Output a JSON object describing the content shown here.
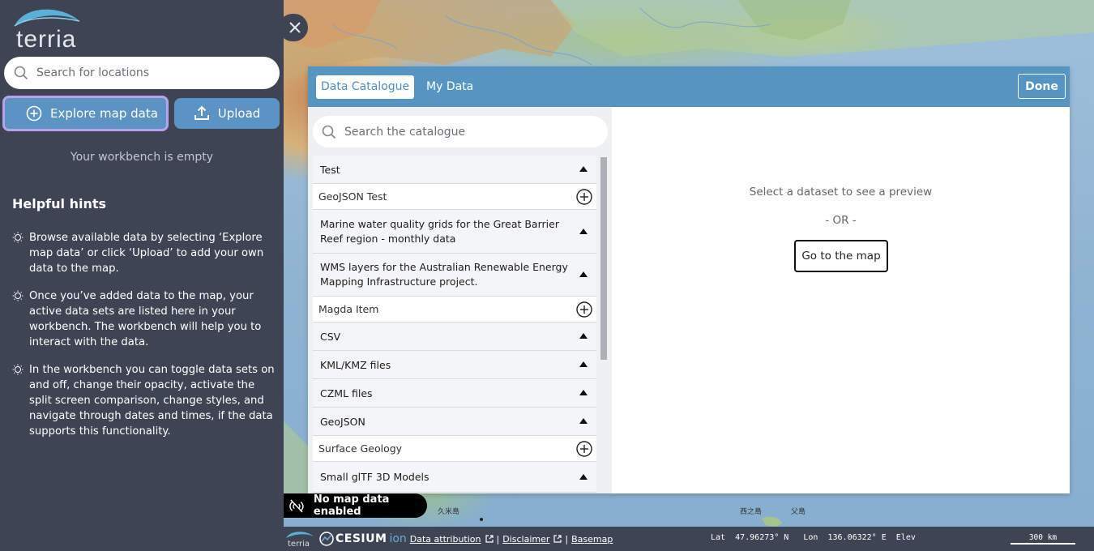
{
  "sidebar": {
    "logo_text": "terria",
    "search_placeholder": "Search for locations",
    "explore_label": "Explore map data",
    "upload_label": "Upload",
    "workbench_empty": "Your workbench is empty",
    "hints_title": "Helpful hints",
    "hints": [
      "Browse available data by selecting ‘Explore map data’ or click ‘Upload’ to add your own data to the map.",
      "Once you’ve added data to the map, your active data sets are listed here in your workbench. The workbench will help you to interact with the data.",
      "In the workbench you can toggle data sets on and off, change their opacity, activate the split screen comparison, change styles, and navigate through dates and times, if the data supports this functionality."
    ]
  },
  "modal": {
    "tabs": [
      "Data Catalogue",
      "My Data"
    ],
    "done_label": "Done",
    "catalogue_search_placeholder": "Search the catalogue",
    "catalogue_items": [
      {
        "label": "Test",
        "type": "group"
      },
      {
        "label": "GeoJSON Test",
        "type": "item"
      },
      {
        "label": "Marine water quality grids for the Great Barrier Reef region - monthly data",
        "type": "group"
      },
      {
        "label": "WMS layers for the Australian Renewable Energy Mapping Infrastructure project.",
        "type": "group"
      },
      {
        "label": "Magda Item",
        "type": "item"
      },
      {
        "label": "CSV",
        "type": "group"
      },
      {
        "label": "KML/KMZ files",
        "type": "group"
      },
      {
        "label": "CZML files",
        "type": "group"
      },
      {
        "label": "GeoJSON",
        "type": "group"
      },
      {
        "label": "Surface Geology",
        "type": "item"
      },
      {
        "label": "Small glTF 3D Models",
        "type": "group"
      }
    ],
    "preview_message": "Select a dataset to see a preview",
    "preview_or": "- OR -",
    "goto_map_label": "Go to the map"
  },
  "map": {
    "no_data_label": "No map data enabled",
    "labels": [
      "久米島",
      "西之島",
      "父島"
    ]
  },
  "bottom_bar": {
    "logo_text": "terria",
    "cesium_text": "CESIUM",
    "ion_text": "ion",
    "data_attribution": "Data attribution",
    "disclaimer": "Disclaimer",
    "basemap": "Basemap",
    "separator": "|",
    "coordinates": "Lat  47.96273° N   Lon  136.06322° E  Elev",
    "scale_label": "300 km"
  },
  "colors": {
    "sidebar_bg": "#3e4454",
    "accent": "#5695c2",
    "button_bg": "#5b94c4",
    "focus_ring": "#b6a3ea"
  }
}
